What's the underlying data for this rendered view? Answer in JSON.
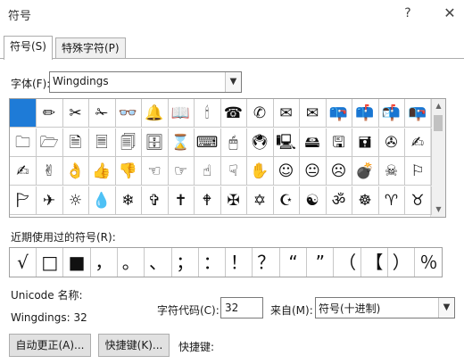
{
  "window": {
    "title": "符号",
    "help_label": "?",
    "close_label": "✕"
  },
  "tabs": [
    {
      "label": "符号(S)"
    },
    {
      "label": "特殊字符(P)"
    }
  ],
  "font_label": "字体(F):",
  "font_value": "Wingdings",
  "symbol_grid": [
    [
      "",
      "✏",
      "✂",
      "✁",
      "👓",
      "🔔",
      "📖",
      "🕯",
      "☎",
      "✆",
      "✉",
      "✉",
      "📪",
      "📫",
      "📬",
      "📭"
    ],
    [
      "🗀",
      "🗁",
      "🗎",
      "🗏",
      "🗐",
      "🗄",
      "⌛",
      "⌨",
      "🖱",
      "🖲",
      "🖳",
      "🖴",
      "🖫",
      "🖬",
      "✇",
      "✍"
    ],
    [
      "✍",
      "✌",
      "👌",
      "👍",
      "👎",
      "☜",
      "☞",
      "☝",
      "☟",
      "✋",
      "☺",
      "😐",
      "☹",
      "💣",
      "☠",
      "⚐"
    ],
    [
      "🏱",
      "✈",
      "☼",
      "💧",
      "❄",
      "✞",
      "✝",
      "🕈",
      "✠",
      "✡",
      "☪",
      "☯",
      "ॐ",
      "☸",
      "♈",
      "♉"
    ]
  ],
  "recent_label": "近期使用过的符号(R):",
  "recent_symbols": [
    "√",
    "□",
    "■",
    "，",
    "。",
    "、",
    "；",
    "：",
    "！",
    "？",
    "“",
    "”",
    "（",
    "【",
    "）",
    "％"
  ],
  "unicode_name_label": "Unicode 名称:",
  "char_name": "Wingdings: 32",
  "char_code_label": "字符代码(C):",
  "char_code_value": "32",
  "from_label": "来自(M):",
  "from_value": "符号(十进制)",
  "autocorrect_button": "自动更正(A)...",
  "shortcut_button": "快捷键(K)...",
  "shortcut_key_label": "快捷键:",
  "colors": {
    "selection": "#1e7bd7",
    "border": "#a0a0a0"
  }
}
